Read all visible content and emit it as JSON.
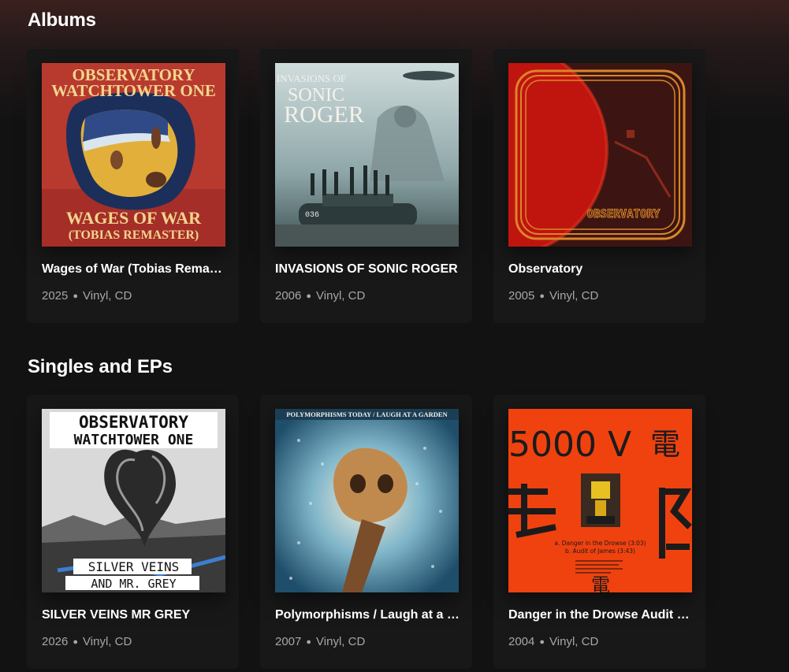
{
  "sections": [
    {
      "title": "Albums",
      "items": [
        {
          "title": "Wages of War (Tobias Remaster)",
          "year": "2025",
          "formats": "Vinyl, CD",
          "cover_text": {
            "top1": "OBSERVATORY",
            "top2": "WATCHTOWER ONE",
            "bottom1": "WAGES OF WAR",
            "bottom2": "(TOBIAS REMASTER)"
          }
        },
        {
          "title": "INVASIONS OF SONIC ROGER",
          "year": "2006",
          "formats": "Vinyl, CD",
          "cover_text": {
            "line1": "INVASIONS OF",
            "line2": "SONIC",
            "line3": "ROGER",
            "tank_id": "036"
          }
        },
        {
          "title": "Observatory",
          "year": "2005",
          "formats": "Vinyl, CD",
          "cover_text": {
            "logo": "OBSERVATORY"
          }
        }
      ]
    },
    {
      "title": "Singles and EPs",
      "items": [
        {
          "title": "SILVER VEINS MR GREY",
          "year": "2026",
          "formats": "Vinyl, CD",
          "cover_text": {
            "top1": "OBSERVATORY",
            "top2": "WATCHTOWER ONE",
            "bottom1": "SILVER VEINS",
            "bottom2": "AND MR. GREY"
          }
        },
        {
          "title": "Polymorphisms / Laugh at a Garden",
          "year": "2007",
          "formats": "Vinyl, CD",
          "cover_text": {
            "header": "POLYMORPHISMS TODAY / LAUGH AT A GARDEN"
          }
        },
        {
          "title": "Danger in the Drowse Audit of James",
          "year": "2004",
          "formats": "Vinyl, CD",
          "cover_text": {
            "voltage": "5000 V",
            "kanji": "電",
            "track_a": "a. Danger in the Drowse (3:03)",
            "track_b": "b. Audit of James (3:43)"
          }
        }
      ]
    }
  ],
  "colors": {
    "background": "#121212",
    "card": "#181818",
    "subtext": "#a7a7a7"
  }
}
